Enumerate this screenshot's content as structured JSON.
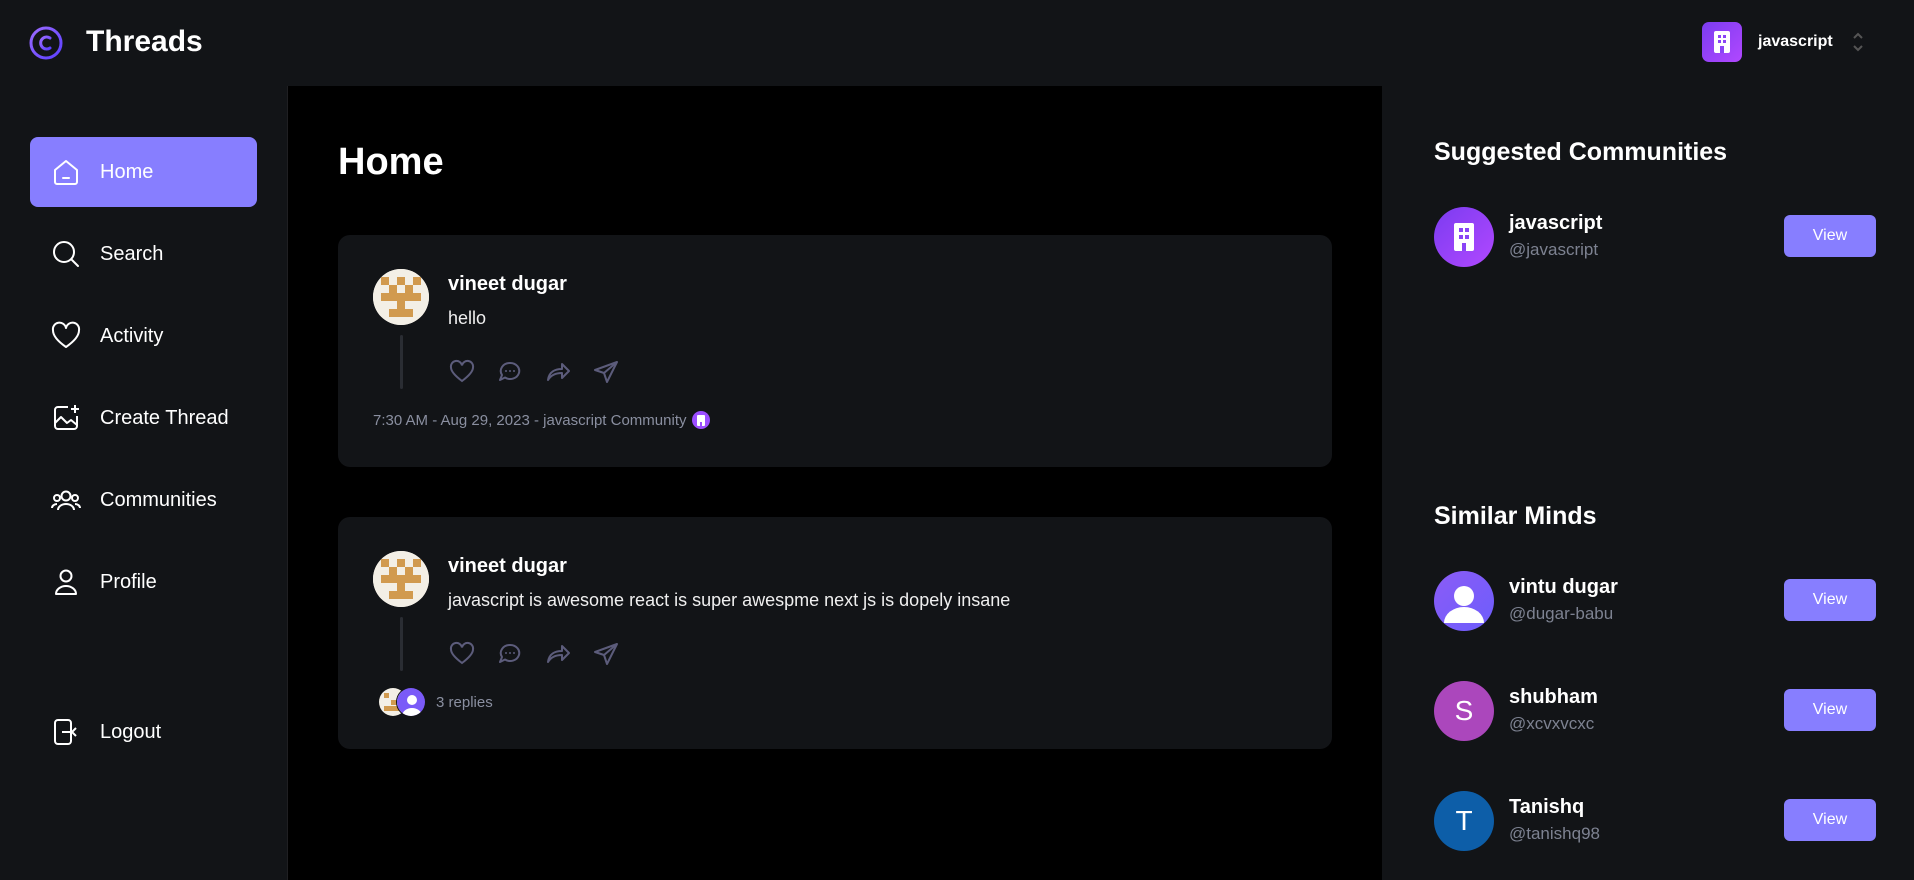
{
  "app": {
    "brand": "Threads",
    "org_name": "javascript"
  },
  "nav": {
    "items": [
      {
        "label": "Home",
        "icon": "home-icon",
        "active": true
      },
      {
        "label": "Search",
        "icon": "search-icon"
      },
      {
        "label": "Activity",
        "icon": "heart-icon"
      },
      {
        "label": "Create Thread",
        "icon": "image-plus-icon"
      },
      {
        "label": "Communities",
        "icon": "users-icon"
      },
      {
        "label": "Profile",
        "icon": "user-icon"
      }
    ],
    "logout": "Logout"
  },
  "main": {
    "title": "Home",
    "threads": [
      {
        "author": "vineet dugar",
        "text": "hello",
        "meta": "7:30 AM - Aug 29, 2023 - javascript Community"
      },
      {
        "author": "vineet dugar",
        "text": "javascript is awesome react is super awespme next js is dopely insane",
        "replies": "3 replies"
      }
    ]
  },
  "right": {
    "communities_title": "Suggested Communities",
    "communities": [
      {
        "name": "javascript",
        "handle": "@javascript",
        "button": "View"
      }
    ],
    "minds_title": "Similar Minds",
    "minds": [
      {
        "name": "vintu dugar",
        "handle": "@dugar-babu",
        "button": "View",
        "initial": ""
      },
      {
        "name": "shubham",
        "handle": "@xcvxvcxc",
        "button": "View",
        "initial": "S"
      },
      {
        "name": "Tanishq",
        "handle": "@tanishq98",
        "button": "View",
        "initial": "T"
      }
    ]
  },
  "colors": {
    "accent": "#877eff",
    "bg": "#121417",
    "main_bg": "#000000"
  }
}
